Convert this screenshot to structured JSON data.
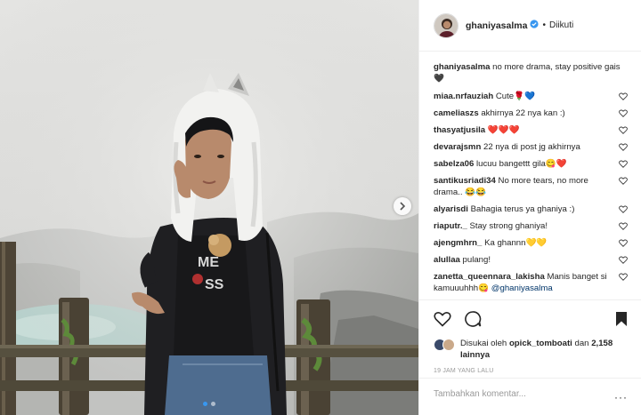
{
  "post": {
    "username": "ghaniyasalma",
    "follow_separator": "•",
    "follow_label": "Diikuti",
    "caption": {
      "user": "ghaniyasalma",
      "text": "no more drama, stay positive gais 🖤"
    },
    "comments": [
      {
        "user": "miaa.nrfauziah",
        "text": "Cute🌹💙"
      },
      {
        "user": "cameliaszs",
        "text": "akhirnya 22 nya kan :)"
      },
      {
        "user": "thasyatjusila",
        "text": "❤️❤️❤️"
      },
      {
        "user": "devarajsmn",
        "text": "22 nya di post jg akhirnya"
      },
      {
        "user": "sabelza06",
        "text": "lucuu bangettt gila😋❤️"
      },
      {
        "user": "santikusriadi34",
        "text": "No more tears, no more drama.. 😂😂"
      },
      {
        "user": "alyarisdi",
        "text": "Bahagia terus ya ghaniya :)"
      },
      {
        "user": "riaputr._",
        "text": "Stay strong ghaniya!"
      },
      {
        "user": "ajengmhrn_",
        "text": "Ka ghannn💛💛"
      },
      {
        "user": "alullaa",
        "text": "pulang!"
      },
      {
        "user": "zanetta_queennara_lakisha",
        "text": "Manis banget si kamuuuhhh😋",
        "mention": "@ghaniyasalma"
      }
    ],
    "likes": {
      "prefix": "Disukai oleh",
      "user": "opick_tomboati",
      "and": "dan",
      "count": "2,158 lainnya"
    },
    "timestamp": "19 JAM YANG LALU",
    "add_comment_placeholder": "Tambahkan komentar...",
    "more_options": "···",
    "carousel": {
      "count": 2,
      "active": 1
    }
  },
  "icons": {
    "like": "heart-outline-icon",
    "comment": "comment-bubble-icon",
    "save": "bookmark-filled-icon",
    "next": "chevron-right-icon",
    "verified": "verified-badge-icon"
  },
  "colors": {
    "link": "#003569",
    "active_dot": "#3897f0",
    "verified": "#3897f0",
    "muted": "#999999"
  }
}
